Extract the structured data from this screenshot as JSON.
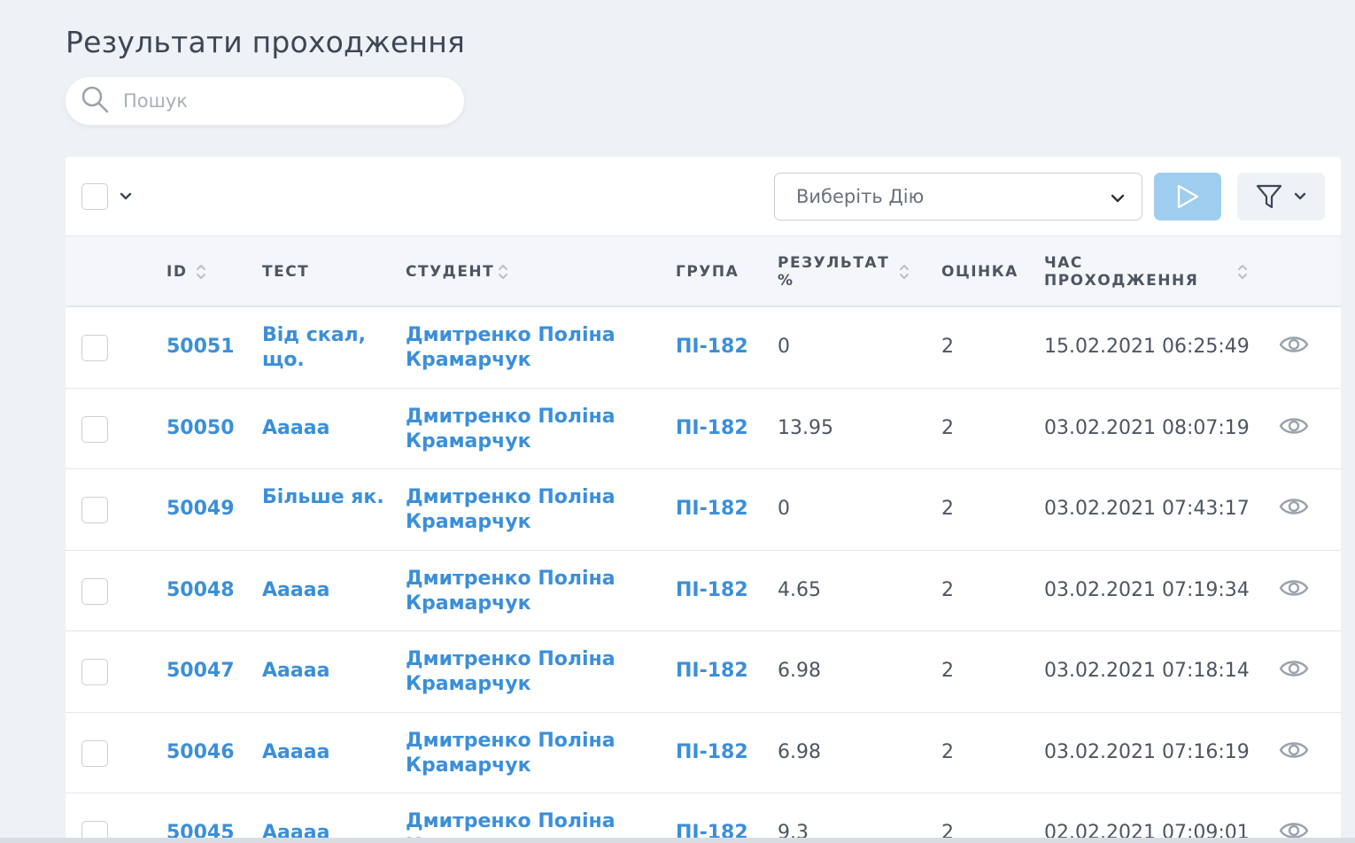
{
  "page": {
    "title": "Результати проходження"
  },
  "search": {
    "placeholder": "Пошук",
    "icon": "search-icon"
  },
  "toolbar": {
    "action_placeholder": "Виберіть Дію",
    "run_icon": "play-icon",
    "filter_icon": "filter-icon",
    "run_button_color": "#9fcdf0"
  },
  "columns": {
    "id": "ID",
    "test": "ТЕСТ",
    "student": "СТУДЕНТ",
    "group": "ГРУПА",
    "result_line1": "РЕЗУЛЬТАТ",
    "result_line2": "%",
    "grade": "ОЦІНКА",
    "time_line1": "ЧАС",
    "time_line2": "ПРОХОДЖЕННЯ"
  },
  "colors": {
    "link": "#3b8fd9",
    "background": "#eef1f5"
  },
  "rows": [
    {
      "id": "50051",
      "test": "Від скал, що.",
      "student": "Дмитренко Поліна Крамарчук",
      "group": "ПІ-182",
      "result": "0",
      "grade": "2",
      "time": "15.02.2021 06:25:49"
    },
    {
      "id": "50050",
      "test": "Ааааа",
      "student": "Дмитренко Поліна Крамарчук",
      "group": "ПІ-182",
      "result": "13.95",
      "grade": "2",
      "time": "03.02.2021 08:07:19"
    },
    {
      "id": "50049",
      "test": "Більше як.",
      "student": "Дмитренко Поліна Крамарчук",
      "group": "ПІ-182",
      "result": "0",
      "grade": "2",
      "time": "03.02.2021 07:43:17"
    },
    {
      "id": "50048",
      "test": "Ааааа",
      "student": "Дмитренко Поліна Крамарчук",
      "group": "ПІ-182",
      "result": "4.65",
      "grade": "2",
      "time": "03.02.2021 07:19:34"
    },
    {
      "id": "50047",
      "test": "Ааааа",
      "student": "Дмитренко Поліна Крамарчук",
      "group": "ПІ-182",
      "result": "6.98",
      "grade": "2",
      "time": "03.02.2021 07:18:14"
    },
    {
      "id": "50046",
      "test": "Ааааа",
      "student": "Дмитренко Поліна Крамарчук",
      "group": "ПІ-182",
      "result": "6.98",
      "grade": "2",
      "time": "03.02.2021 07:16:19"
    },
    {
      "id": "50045",
      "test": "Ааааа",
      "student": "Дмитренко Поліна Крамарчук",
      "group": "ПІ-182",
      "result": "9.3",
      "grade": "2",
      "time": "02.02.2021 07:09:01"
    }
  ]
}
